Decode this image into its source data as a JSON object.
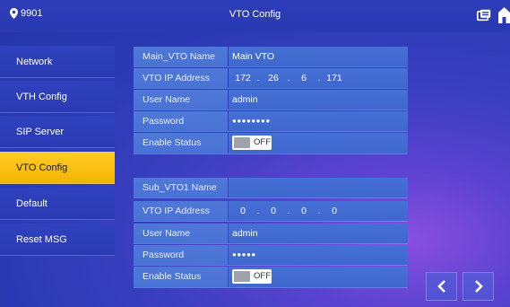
{
  "header": {
    "room": "9901",
    "title": "VTO Config",
    "icons": [
      "location-pin-icon",
      "message-icon",
      "home-icon"
    ]
  },
  "sidebar": {
    "items": [
      {
        "label": "Network"
      },
      {
        "label": "VTH Config"
      },
      {
        "label": "SIP Server"
      },
      {
        "label": "VTO Config",
        "active": true
      },
      {
        "label": "Default"
      },
      {
        "label": "Reset MSG"
      }
    ]
  },
  "main_vto": {
    "name_label": "Main_VTO Name",
    "name_value": "Main VTO",
    "ip_label": "VTO IP Address",
    "ip": [
      "172",
      "26",
      "6",
      "171"
    ],
    "user_label": "User Name",
    "user_value": "admin",
    "password_label": "Password",
    "password_value": "●●●●●●●●",
    "status_label": "Enable Status",
    "status_value": "OFF"
  },
  "sub_vto1": {
    "name_label": "Sub_VTO1 Name",
    "name_value": "",
    "ip_label": "VTO IP Address",
    "ip": [
      "0",
      "0",
      "0",
      "0"
    ],
    "user_label": "User Name",
    "user_value": "admin",
    "password_label": "Password",
    "password_value": "●●●●●",
    "status_label": "Enable Status",
    "status_value": "OFF"
  },
  "colors": {
    "accent": "#f7bd0d",
    "bar": "#2c3cb8",
    "label_cell": "#4f78d8",
    "value_cell": "#4670d5"
  },
  "nav": {
    "prev_icon": "chevron-left-icon",
    "next_icon": "chevron-right-icon"
  }
}
